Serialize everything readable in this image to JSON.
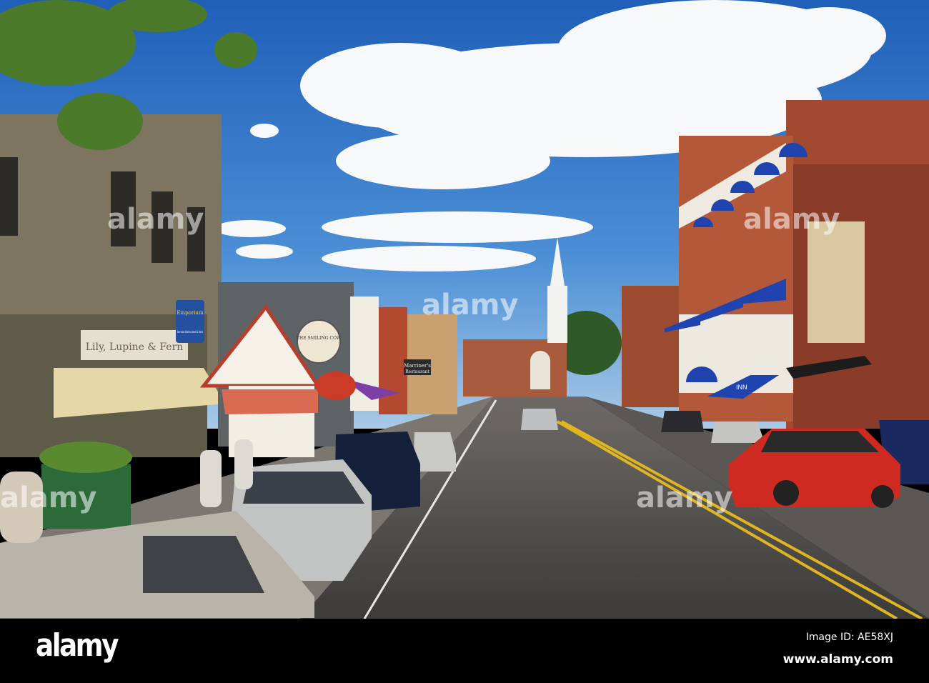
{
  "photo": {
    "subject": "Main street with shops, parked cars and white church steeple",
    "signs": {
      "lily": "Lily, Lupine & Fern",
      "emporium": "Emporium",
      "emporium_sub": "fine wines flowers,cheese & brews",
      "cow": "THE SMILING COW",
      "marriners": "Marriner's",
      "marriners_sub": "Restaurant",
      "inn": "INN"
    },
    "watermark": "alamy"
  },
  "footer": {
    "logo": "alamy",
    "image_id": "Image ID: AE58XJ",
    "website": "www.alamy.com"
  }
}
